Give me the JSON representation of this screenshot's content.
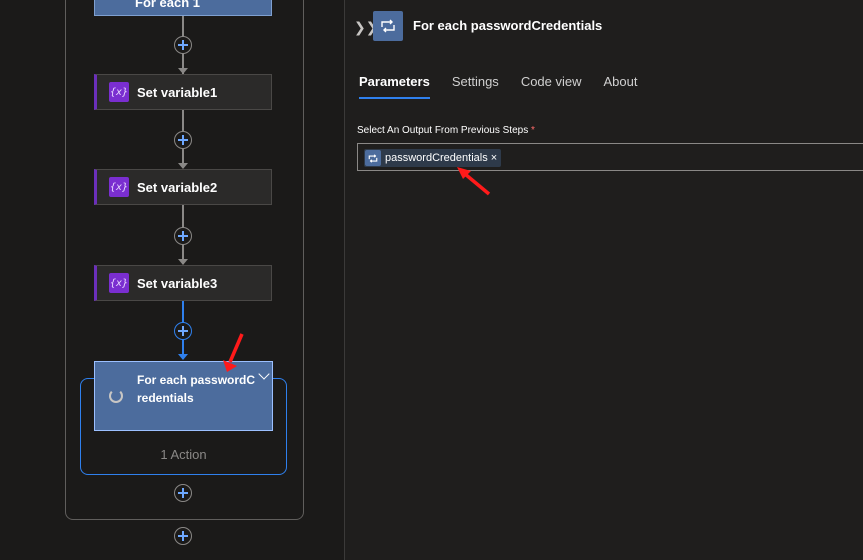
{
  "canvas": {
    "top_node_label": "For each 1",
    "steps": [
      {
        "label": "Set variable1",
        "icon": "variable-icon"
      },
      {
        "label": "Set variable2",
        "icon": "variable-icon"
      },
      {
        "label": "Set variable3",
        "icon": "variable-icon"
      }
    ],
    "variable_icon_glyph": "{x}",
    "loop_node": {
      "label": "For each passwordCredentials"
    },
    "loop_action_count": "1 Action"
  },
  "panel": {
    "title": "For each passwordCredentials",
    "tabs": [
      "Parameters",
      "Settings",
      "Code view",
      "About"
    ],
    "active_tab": "Parameters",
    "field_label": "Select An Output From Previous Steps",
    "field_required_mark": "*",
    "token_label": "passwordCredentials",
    "token_close": "×"
  },
  "colors": {
    "accent": "#2f80ed",
    "variable": "#7a2ed0",
    "loop": "#4c6c9d",
    "annotation_arrow": "#ff1a1a"
  }
}
